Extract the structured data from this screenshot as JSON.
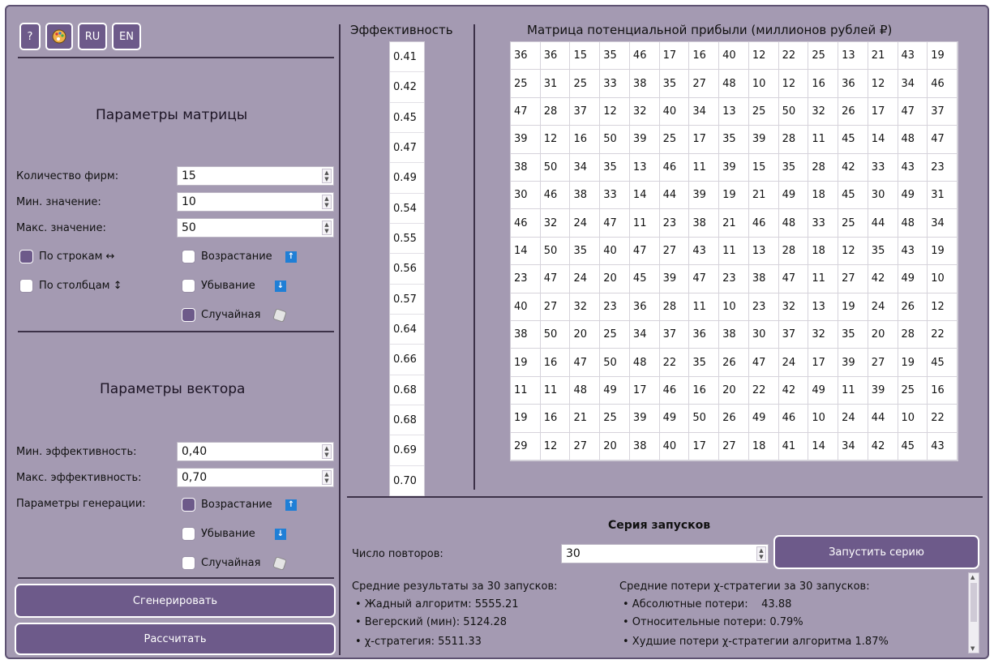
{
  "toolbar": {
    "help_label": "?",
    "lang_ru": "RU",
    "lang_en": "EN"
  },
  "matrix_params": {
    "title": "Параметры матрицы",
    "firms_label": "Количество фирм:",
    "firms_value": "15",
    "min_label": "Мин. значение:",
    "min_value": "10",
    "max_label": "Макс. значение:",
    "max_value": "50",
    "by_rows_label": "По строкам ↔",
    "by_rows_checked": true,
    "by_cols_label": "По столбцам ↕",
    "by_cols_checked": false,
    "ascending_label": "Возрастание",
    "ascending_checked": false,
    "descending_label": "Убывание",
    "descending_checked": false,
    "random_label": "Случайная",
    "random_checked": true
  },
  "vector_params": {
    "title": "Параметры вектора",
    "min_eff_label": "Мин. эффективность:",
    "min_eff_value": "0,40",
    "max_eff_label": "Макс. эффективность:",
    "max_eff_value": "0,70",
    "gen_label": "Параметры генерации:",
    "ascending_label": "Возрастание",
    "ascending_checked": true,
    "descending_label": "Убывание",
    "descending_checked": false,
    "random_label": "Случайная",
    "random_checked": false
  },
  "actions": {
    "generate_label": "Сгенерировать",
    "calculate_label": "Рассчитать"
  },
  "efficiency": {
    "header": "Эффективность",
    "values": [
      "0.41",
      "0.42",
      "0.45",
      "0.47",
      "0.49",
      "0.54",
      "0.55",
      "0.56",
      "0.57",
      "0.64",
      "0.66",
      "0.68",
      "0.68",
      "0.69",
      "0.70"
    ]
  },
  "matrix": {
    "header": "Матрица потенциальной прибыли (миллионов рублей ₽)",
    "rows": [
      [
        36,
        36,
        15,
        35,
        46,
        17,
        16,
        40,
        12,
        22,
        25,
        13,
        21,
        43,
        19
      ],
      [
        25,
        31,
        25,
        33,
        38,
        35,
        27,
        48,
        10,
        12,
        16,
        36,
        12,
        34,
        46
      ],
      [
        47,
        28,
        37,
        12,
        32,
        40,
        34,
        13,
        25,
        50,
        32,
        26,
        17,
        47,
        37
      ],
      [
        39,
        12,
        16,
        50,
        39,
        25,
        17,
        35,
        39,
        28,
        11,
        45,
        14,
        48,
        47
      ],
      [
        38,
        50,
        34,
        35,
        13,
        46,
        11,
        39,
        15,
        35,
        28,
        42,
        33,
        43,
        23
      ],
      [
        30,
        46,
        38,
        33,
        14,
        44,
        39,
        19,
        21,
        49,
        18,
        45,
        30,
        49,
        31
      ],
      [
        46,
        32,
        24,
        47,
        11,
        23,
        38,
        21,
        46,
        48,
        33,
        25,
        44,
        48,
        34
      ],
      [
        14,
        50,
        35,
        40,
        47,
        27,
        43,
        11,
        13,
        28,
        18,
        12,
        35,
        43,
        19
      ],
      [
        23,
        47,
        24,
        20,
        45,
        39,
        47,
        23,
        38,
        47,
        11,
        27,
        42,
        49,
        10
      ],
      [
        40,
        27,
        32,
        23,
        36,
        28,
        11,
        10,
        23,
        32,
        13,
        19,
        24,
        26,
        12
      ],
      [
        38,
        50,
        20,
        25,
        34,
        37,
        36,
        38,
        30,
        37,
        32,
        35,
        20,
        28,
        22
      ],
      [
        19,
        16,
        47,
        50,
        48,
        22,
        35,
        26,
        47,
        24,
        17,
        39,
        27,
        19,
        45
      ],
      [
        11,
        11,
        48,
        49,
        17,
        46,
        16,
        20,
        22,
        42,
        49,
        11,
        39,
        25,
        16
      ],
      [
        19,
        16,
        21,
        25,
        39,
        49,
        50,
        26,
        49,
        46,
        10,
        24,
        44,
        10,
        22
      ],
      [
        29,
        12,
        27,
        20,
        38,
        40,
        17,
        27,
        18,
        41,
        14,
        34,
        42,
        45,
        43
      ]
    ]
  },
  "series": {
    "title": "Серия запусков",
    "repeats_label": "Число повторов:",
    "repeats_value": "30",
    "run_label": "Запустить серию",
    "avg_title": "Средние результаты за 30 запусков:",
    "greedy": "• Жадный алгоритм: 5555.21",
    "hungarian": "• Вегерский (мин): 5124.28",
    "chi": "• χ-стратегия: 5511.33",
    "loss_title": "Средние потери χ-стратегии за 30 запусков:",
    "abs_loss": "• Абсолютные потери:    43.88",
    "rel_loss": "• Относительные потери: 0.79%",
    "worst_loss": "• Худшие потери χ-стратегии алгоритма 1.87%"
  },
  "colors": {
    "panel": "#a49ab2",
    "button": "#6d5a8a",
    "accent_blue": "#1f7fd6"
  }
}
